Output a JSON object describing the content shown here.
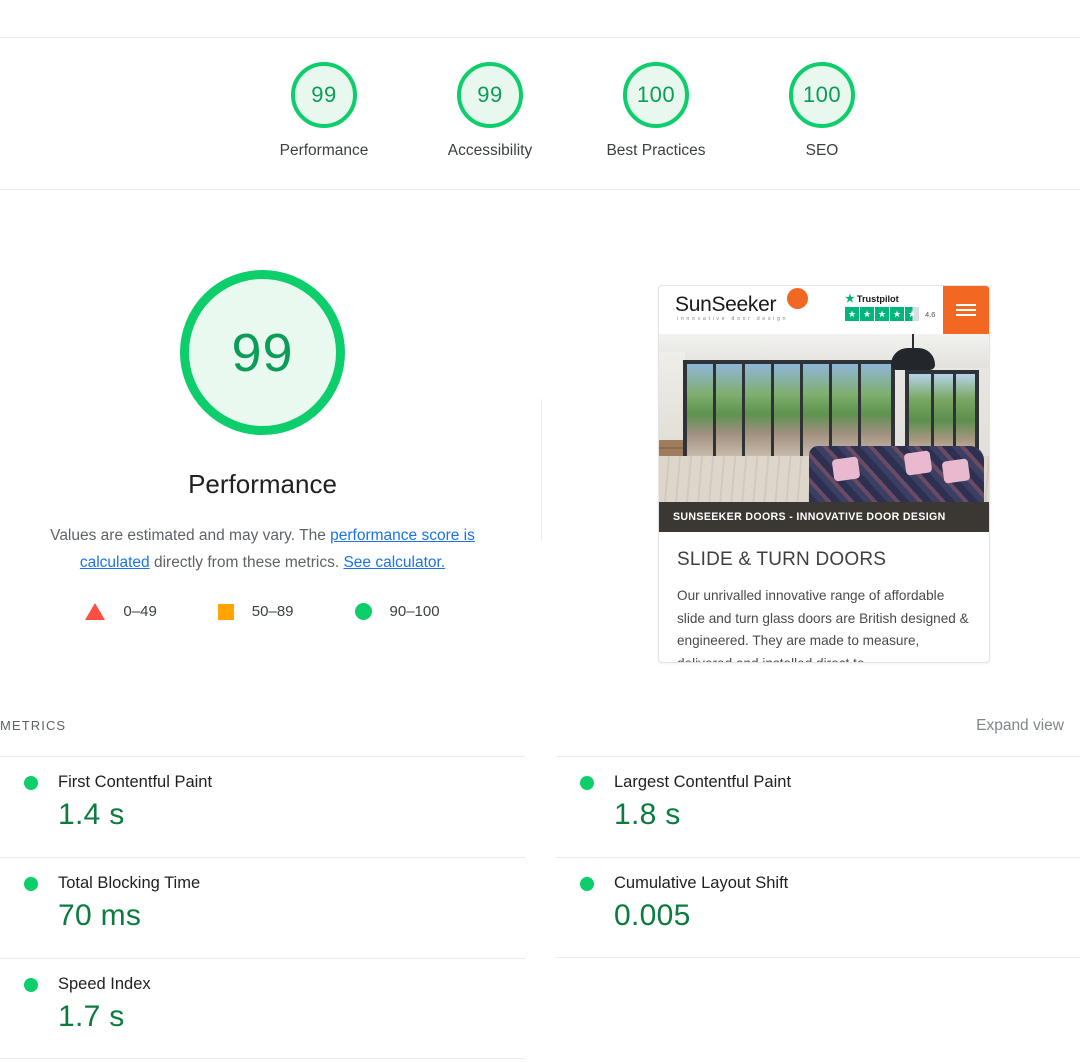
{
  "category_scores": [
    {
      "score": "99",
      "label": "Performance"
    },
    {
      "score": "99",
      "label": "Accessibility"
    },
    {
      "score": "100",
      "label": "Best Practices"
    },
    {
      "score": "100",
      "label": "SEO"
    }
  ],
  "performance": {
    "score": "99",
    "title": "Performance",
    "desc_prefix": "Values are estimated and may vary. The ",
    "desc_link1": "performance score is calculated",
    "desc_middle": " directly from these metrics. ",
    "desc_link2": "See calculator."
  },
  "legend": [
    {
      "icon": "triangle-icon",
      "range": "0–49",
      "color": "#ff4e42"
    },
    {
      "icon": "square-icon",
      "range": "50–89",
      "color": "#ffa400"
    },
    {
      "icon": "circle-icon",
      "range": "90–100",
      "color": "#0cce6b"
    }
  ],
  "metrics_section": {
    "title": "METRICS",
    "expand_label": "Expand view"
  },
  "metrics_left": [
    {
      "name": "First Contentful Paint",
      "value": "1.4 s",
      "status": "good"
    },
    {
      "name": "Total Blocking Time",
      "value": "70 ms",
      "status": "good"
    },
    {
      "name": "Speed Index",
      "value": "1.7 s",
      "status": "good"
    }
  ],
  "metrics_right": [
    {
      "name": "Largest Contentful Paint",
      "value": "1.8 s",
      "status": "good"
    },
    {
      "name": "Cumulative Layout Shift",
      "value": "0.005",
      "status": "good"
    }
  ],
  "thumbnail": {
    "logo_text": "SunSeeker",
    "tagline": "innovative  door  design",
    "trustpilot_name": "Trustpilot",
    "trustpilot_score": "4.6",
    "caption": "SUNSEEKER DOORS - INNOVATIVE DOOR DESIGN",
    "heading": "SLIDE & TURN DOORS",
    "paragraph": "Our unrivalled innovative range of affordable slide and turn glass doors are British designed & engineered. They are made to measure, delivered and installed direct to"
  },
  "colors": {
    "good_green": "#0cce6b",
    "value_green": "#0a7c3d",
    "average_orange": "#ffa400",
    "poor_red": "#ff4e42",
    "link_blue": "#1a73e8",
    "brand_orange": "#f26722"
  }
}
